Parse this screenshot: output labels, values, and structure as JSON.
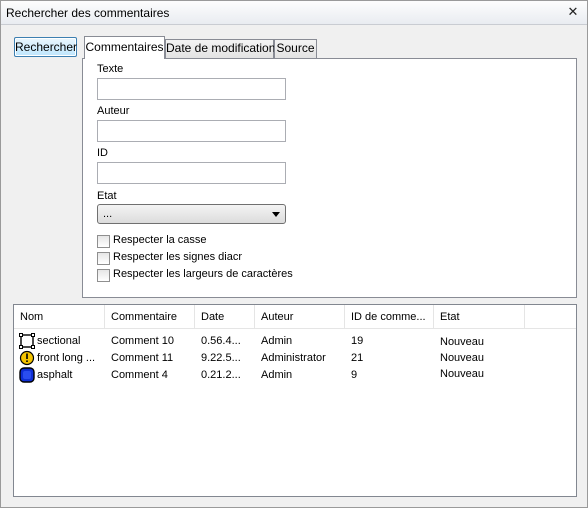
{
  "window": {
    "title": "Rechercher des commentaires",
    "close_glyph": "✕"
  },
  "search_button": {
    "label": "Rechercher"
  },
  "tabs": [
    {
      "label": "Commentaires",
      "active": true
    },
    {
      "label": "Date de modification",
      "active": false
    },
    {
      "label": "Source",
      "active": false
    }
  ],
  "form": {
    "text_label": "Texte",
    "text_value": "",
    "author_label": "Auteur",
    "author_value": "",
    "id_label": "ID",
    "id_value": "",
    "state_label": "Etat",
    "state_value": "...",
    "checkboxes": [
      {
        "label": "Respecter la casse",
        "checked": false
      },
      {
        "label": "Respecter les signes diacr",
        "checked": false
      },
      {
        "label": "Respecter les largeurs de caractères",
        "checked": false
      }
    ]
  },
  "results": {
    "columns": [
      "Nom",
      "Commentaire",
      "Date",
      "Auteur",
      "ID de comme...",
      "Etat"
    ],
    "rows": [
      {
        "icon": "film-frame-icon",
        "name": "sectional",
        "comment": "Comment 10",
        "date": "0.56.4...",
        "author": "Admin",
        "id": "19"
      },
      {
        "icon": "warning-icon",
        "name": "front long ...",
        "comment": "Comment 11",
        "date": "9.22.5...",
        "author": "Administrator",
        "id": "21"
      },
      {
        "icon": "blue-square-icon",
        "name": "asphalt",
        "comment": "Comment 4",
        "date": "0.21.2...",
        "author": "Admin",
        "id": "9"
      }
    ],
    "status_values": [
      "Nouveau",
      "Nouveau",
      "Nouveau"
    ]
  },
  "colors": {
    "accent": "#3c7fb1",
    "warning": "#f5c400",
    "blue_square": "#0f2fd6"
  }
}
